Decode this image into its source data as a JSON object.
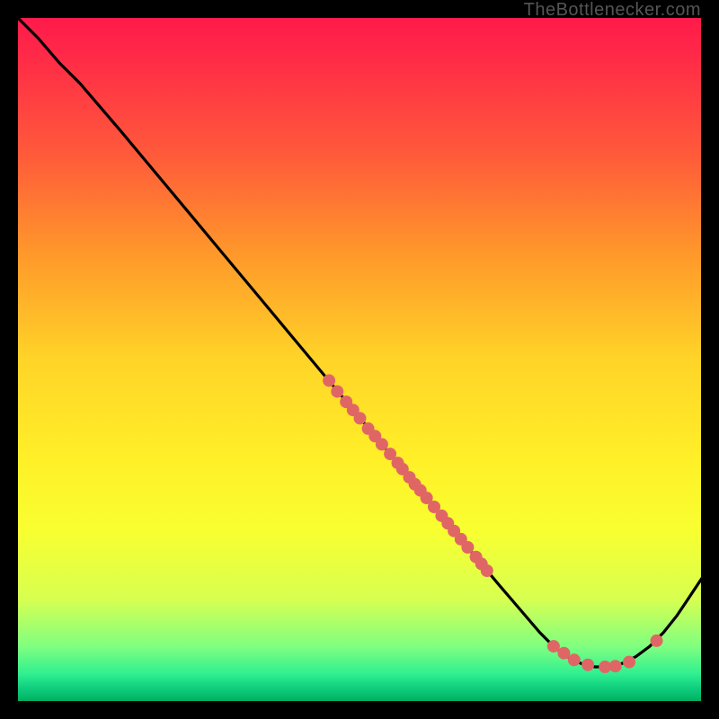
{
  "watermark": "TheBottlenecker.com",
  "chart_data": {
    "type": "line",
    "title": "",
    "xlabel": "",
    "ylabel": "",
    "xlim": [
      0,
      1
    ],
    "ylim": [
      0,
      1
    ],
    "curve": [
      {
        "x": 0.0,
        "y": 1.0
      },
      {
        "x": 0.03,
        "y": 0.97
      },
      {
        "x": 0.06,
        "y": 0.935
      },
      {
        "x": 0.09,
        "y": 0.905
      },
      {
        "x": 0.12,
        "y": 0.87
      },
      {
        "x": 0.15,
        "y": 0.835
      },
      {
        "x": 0.2,
        "y": 0.775
      },
      {
        "x": 0.25,
        "y": 0.715
      },
      {
        "x": 0.3,
        "y": 0.655
      },
      {
        "x": 0.35,
        "y": 0.595
      },
      {
        "x": 0.4,
        "y": 0.535
      },
      {
        "x": 0.45,
        "y": 0.475
      },
      {
        "x": 0.5,
        "y": 0.415
      },
      {
        "x": 0.55,
        "y": 0.355
      },
      {
        "x": 0.6,
        "y": 0.295
      },
      {
        "x": 0.65,
        "y": 0.235
      },
      {
        "x": 0.7,
        "y": 0.175
      },
      {
        "x": 0.73,
        "y": 0.14
      },
      {
        "x": 0.76,
        "y": 0.105
      },
      {
        "x": 0.78,
        "y": 0.085
      },
      {
        "x": 0.8,
        "y": 0.07
      },
      {
        "x": 0.82,
        "y": 0.06
      },
      {
        "x": 0.84,
        "y": 0.055
      },
      {
        "x": 0.86,
        "y": 0.055
      },
      {
        "x": 0.88,
        "y": 0.06
      },
      {
        "x": 0.9,
        "y": 0.07
      },
      {
        "x": 0.92,
        "y": 0.085
      },
      {
        "x": 0.94,
        "y": 0.105
      },
      {
        "x": 0.96,
        "y": 0.13
      },
      {
        "x": 0.98,
        "y": 0.16
      },
      {
        "x": 1.0,
        "y": 0.19
      }
    ],
    "scatter_points": [
      {
        "x": 0.453,
        "y": 0.472
      },
      {
        "x": 0.465,
        "y": 0.456
      },
      {
        "x": 0.478,
        "y": 0.441
      },
      {
        "x": 0.488,
        "y": 0.429
      },
      {
        "x": 0.498,
        "y": 0.417
      },
      {
        "x": 0.51,
        "y": 0.402
      },
      {
        "x": 0.52,
        "y": 0.391
      },
      {
        "x": 0.53,
        "y": 0.379
      },
      {
        "x": 0.542,
        "y": 0.365
      },
      {
        "x": 0.553,
        "y": 0.352
      },
      {
        "x": 0.56,
        "y": 0.343
      },
      {
        "x": 0.57,
        "y": 0.331
      },
      {
        "x": 0.578,
        "y": 0.321
      },
      {
        "x": 0.586,
        "y": 0.312
      },
      {
        "x": 0.595,
        "y": 0.301
      },
      {
        "x": 0.606,
        "y": 0.288
      },
      {
        "x": 0.617,
        "y": 0.275
      },
      {
        "x": 0.626,
        "y": 0.264
      },
      {
        "x": 0.635,
        "y": 0.253
      },
      {
        "x": 0.645,
        "y": 0.241
      },
      {
        "x": 0.655,
        "y": 0.229
      },
      {
        "x": 0.667,
        "y": 0.215
      },
      {
        "x": 0.675,
        "y": 0.205
      },
      {
        "x": 0.683,
        "y": 0.195
      },
      {
        "x": 0.78,
        "y": 0.085
      },
      {
        "x": 0.795,
        "y": 0.075
      },
      {
        "x": 0.81,
        "y": 0.065
      },
      {
        "x": 0.83,
        "y": 0.058
      },
      {
        "x": 0.855,
        "y": 0.055
      },
      {
        "x": 0.87,
        "y": 0.056
      },
      {
        "x": 0.89,
        "y": 0.062
      },
      {
        "x": 0.93,
        "y": 0.093
      }
    ],
    "point_color": "#e06666",
    "curve_color": "#000000",
    "grid": false,
    "legend": false
  }
}
